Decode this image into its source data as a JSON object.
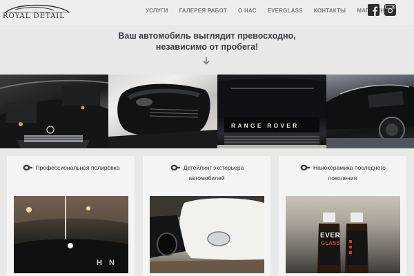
{
  "header": {
    "logo_text": "ROYAL DETAIL",
    "nav": [
      {
        "label": "УСЛУГИ"
      },
      {
        "label": "ГАЛЕРЕЯ РАБОТ"
      },
      {
        "label": "О НАС"
      },
      {
        "label": "EVERGLASS"
      },
      {
        "label": "КОНТАКТЫ"
      },
      {
        "label": "МАГАЗИН"
      }
    ],
    "social": {
      "facebook_icon": "facebook-icon",
      "instagram_icon": "instagram-icon"
    }
  },
  "hero": {
    "title_line1": "Ваш автомобиль выглядит превосходно,",
    "title_line2": "независимо от пробега!",
    "arrow_icon": "arrow-down-icon"
  },
  "gallery": {
    "photos": [
      {
        "subject": "black sedan engine bay close-up"
      },
      {
        "subject": "carbon fiber side mirror"
      },
      {
        "subject": "Range Rover hood and grille",
        "badge": "RANGE ROVER"
      },
      {
        "subject": "glossy black car side in showroom"
      }
    ]
  },
  "features": [
    {
      "title_line1": "Профессиональная полировка",
      "title_line2": "",
      "icon": "polisher-icon"
    },
    {
      "title_line1": "Детейлинг экстерьера",
      "title_line2": "автомобилей",
      "icon": "polisher-icon"
    },
    {
      "title_line1": "Нанокерамика последнего",
      "title_line2": "поколения",
      "icon": "polisher-icon"
    }
  ],
  "feature_images": {
    "third_product_label": "EVER",
    "third_product_sub": "GLASS"
  },
  "colors": {
    "header_bg": "#ededed",
    "page_bg": "#e8e8e8",
    "nav_text": "#7a7a7a",
    "title_text": "#3b3e46"
  }
}
